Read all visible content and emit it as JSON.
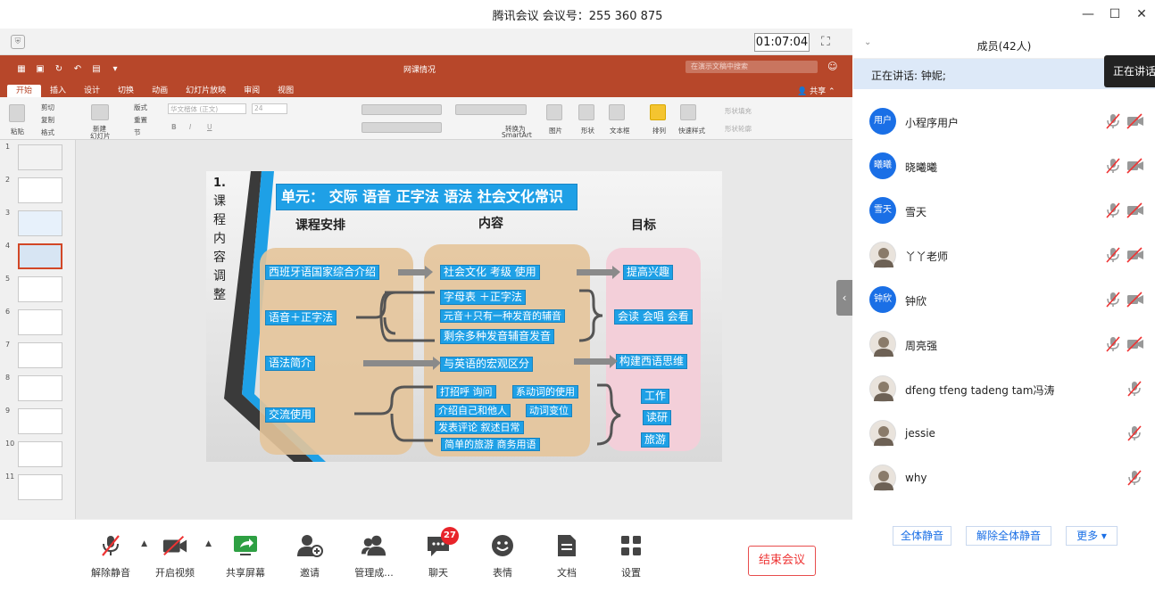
{
  "window": {
    "title": "腾讯会议 会议号：255 360 875",
    "minimize": "—",
    "maximize": "☐",
    "close": "✕"
  },
  "share_bar": {
    "timer": "01:07:04"
  },
  "ppt": {
    "doc_title": "网课情况",
    "search_placeholder": "在演示文稿中搜索",
    "tabs": [
      "开始",
      "插入",
      "设计",
      "切换",
      "动画",
      "幻灯片放映",
      "审阅",
      "视图"
    ],
    "share": "共享",
    "ribbon": {
      "paste": "粘贴",
      "cut": "剪切",
      "copy": "复制",
      "format": "格式",
      "new_slide_1": "新建",
      "new_slide_2": "幻灯片",
      "layout": "版式",
      "reset": "重置",
      "section": "节",
      "font": "华文楷体 (正文)",
      "font_size": "24",
      "convert_1": "转换为",
      "convert_2": "SmartArt",
      "picture": "图片",
      "shape": "形状",
      "textbox": "文本框",
      "arrange": "排列",
      "quick_style": "快速样式",
      "shape_fill": "形状填充",
      "shape_outline": "形状轮廓"
    },
    "thumb_numbers": [
      "1",
      "2",
      "3",
      "4",
      "5",
      "6",
      "7",
      "8",
      "9",
      "10",
      "11"
    ]
  },
  "slide": {
    "num": "1.",
    "vertical": [
      "课",
      "程",
      "内",
      "容",
      "调",
      "整"
    ],
    "title": "单元： 交际 语音 正字法 语法 社会文化常识",
    "head_schedule": "课程安排",
    "head_content": "内容",
    "head_goal": "目标",
    "schedule": [
      "西班牙语国家综合介绍",
      "语音＋正字法",
      "语法简介",
      "交流使用"
    ],
    "content": [
      "社会文化 考级 使用",
      "字母表 ＋正字法",
      "元音＋只有一种发音的辅音",
      "剩余多种发音辅音发音",
      "与英语的宏观区分"
    ],
    "content_small": [
      "打招呼 询问",
      "系动词的使用",
      "介绍自己和他人",
      "动词变位",
      "发表评论 叙述日常",
      "简单的旅游 商务用语"
    ],
    "goals": [
      "提高兴趣",
      "会读 会唱 会看",
      "构建西语思维",
      "工作",
      "读研",
      "旅游"
    ]
  },
  "toolbar": {
    "unmute": "解除静音",
    "start_video": "开启视频",
    "share_screen": "共享屏幕",
    "invite": "邀请",
    "manage": "管理成...",
    "chat": "聊天",
    "chat_badge": "27",
    "emoji": "表情",
    "docs": "文档",
    "settings": "设置",
    "end_meeting": "结束会议"
  },
  "members_panel": {
    "title": "成员(42人)",
    "speaking": "正在讲话: 钟妮;",
    "tooltip": "正在讲话",
    "members": [
      {
        "name": "小程序用户",
        "avatar": "用户",
        "has_image": false
      },
      {
        "name": "晓曦曦",
        "avatar": "曦曦",
        "has_image": false
      },
      {
        "name": "雪天",
        "avatar": "雪天",
        "has_image": false
      },
      {
        "name": "丫丫老师",
        "avatar": "",
        "has_image": true
      },
      {
        "name": "钟欣",
        "avatar": "钟欣",
        "has_image": false
      },
      {
        "name": "周亮强",
        "avatar": "",
        "has_image": true
      },
      {
        "name": "dfeng tfeng tadeng tam冯涛",
        "avatar": "",
        "has_image": true
      },
      {
        "name": "jessie",
        "avatar": "",
        "has_image": true
      },
      {
        "name": "why",
        "avatar": "",
        "has_image": true
      }
    ],
    "mute_all": "全体静音",
    "unmute_all": "解除全体静音",
    "more": "更多"
  },
  "colors": {
    "ppt_red": "#b7472a",
    "slide_blue": "#1ea0e6",
    "tencent_blue": "#1a6fe6",
    "end_red": "#e84d4d"
  }
}
